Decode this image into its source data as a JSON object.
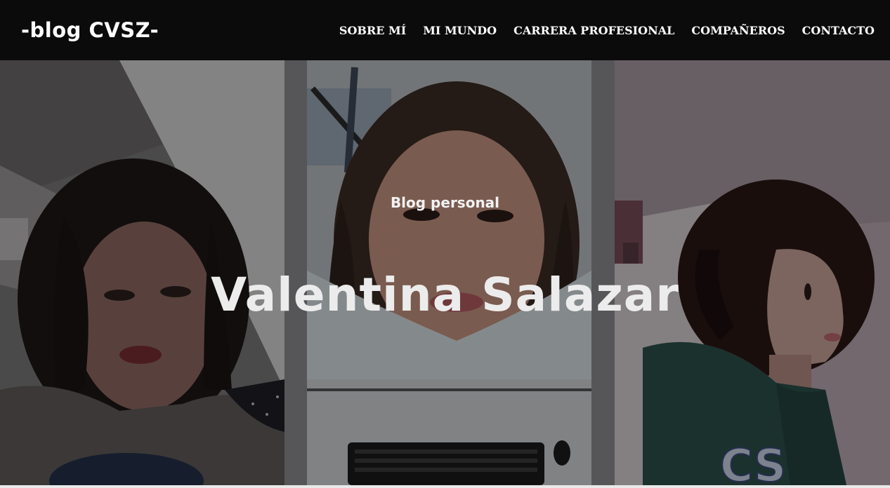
{
  "header": {
    "brand": "-blog CVSZ-",
    "nav": [
      {
        "label": "SOBRE MÍ"
      },
      {
        "label": "MI MUNDO"
      },
      {
        "label": "CARRERA PROFESIONAL"
      },
      {
        "label": "COMPAÑEROS"
      },
      {
        "label": "CONTACTO"
      }
    ]
  },
  "hero": {
    "subtitle": "Blog personal",
    "title": "Valentina Salazar",
    "photos": [
      "left-portrait-photo",
      "center-portrait-photo",
      "right-profile-photo"
    ]
  },
  "colors": {
    "navbar_bg": "#0b0b0b",
    "nav_text": "#ffffff",
    "hero_text": "#ececec"
  }
}
